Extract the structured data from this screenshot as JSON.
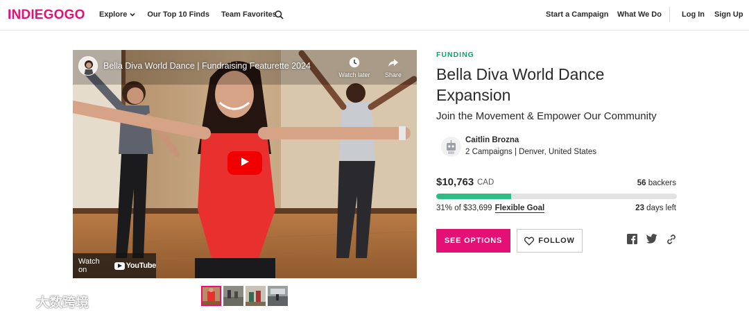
{
  "header": {
    "logo": "INDIEGOGO",
    "nav_left": [
      {
        "label": "Explore",
        "has_dropdown": true
      },
      {
        "label": "Our Top 10 Finds"
      },
      {
        "label": "Team Favorites"
      }
    ],
    "nav_right": {
      "start_campaign": "Start a Campaign",
      "what_we_do": "What We Do",
      "login": "Log In",
      "signup": "Sign Up"
    },
    "brand_color": "#e51075"
  },
  "video": {
    "title": "Bella Diva World Dance | Fundraising Featurette 2024",
    "watch_later": "Watch later",
    "share": "Share",
    "watch_on": "Watch on",
    "youtube": "YouTube"
  },
  "campaign": {
    "status": "FUNDING",
    "title": "Bella Diva World Dance Expansion",
    "tagline": "Join the Movement & Empower Our Community",
    "owner": {
      "name": "Caitlin Brozna",
      "meta": "2 Campaigns | Denver, United States"
    },
    "raised": "$10,763",
    "currency": "CAD",
    "backers_count": "56",
    "backers_label": "backers",
    "goal_text": "31% of $33,699",
    "goal_type": "Flexible Goal",
    "progress_fraction": 0.31,
    "days_left_count": "23",
    "days_left_label": "days left",
    "see_options": "SEE OPTIONS",
    "follow": "FOLLOW",
    "accent_green": "#2bbd84"
  },
  "watermark": {
    "text": "大数跨境"
  }
}
